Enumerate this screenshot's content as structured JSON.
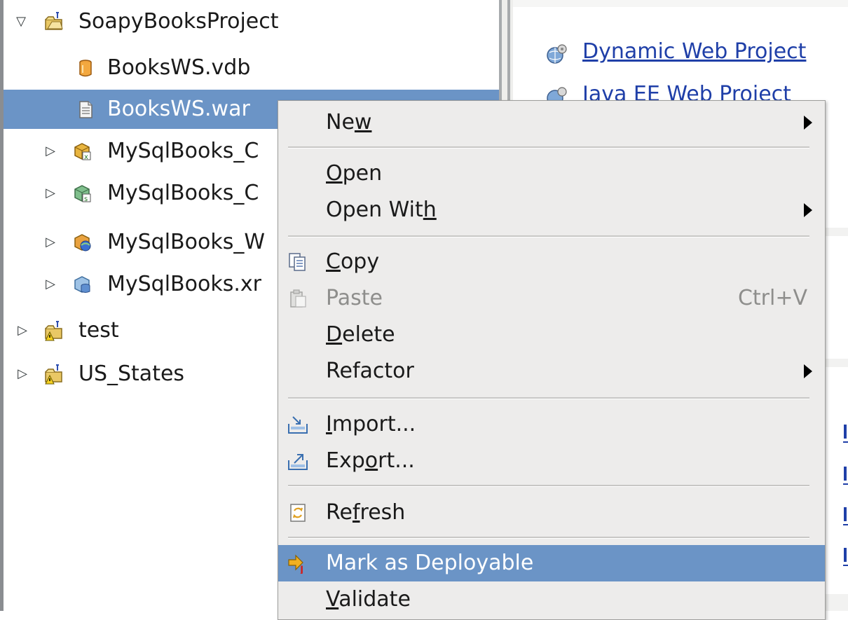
{
  "tree": {
    "items": [
      {
        "label": "SoapyBooksProject",
        "expander": "expanded-triangle",
        "icon": "project-folder-icon"
      },
      {
        "label": "BooksWS.vdb",
        "icon": "vdb-cylinder-icon"
      },
      {
        "label": "BooksWS.war",
        "icon": "war-file-icon"
      },
      {
        "label": "MySqlBooks_C",
        "expander": "collapsed-triangle",
        "icon": "model-xsd-icon"
      },
      {
        "label": "MySqlBooks_C",
        "expander": "collapsed-triangle",
        "icon": "model-source-icon"
      },
      {
        "label": "MySqlBooks_W",
        "expander": "collapsed-triangle",
        "icon": "model-webservice-icon"
      },
      {
        "label": "MySqlBooks.xr",
        "expander": "collapsed-triangle",
        "icon": "model-relational-icon"
      },
      {
        "label": "test",
        "expander": "collapsed-triangle",
        "icon": "project-warning-icon"
      },
      {
        "label": "US_States",
        "expander": "collapsed-triangle",
        "icon": "project-warning-icon"
      }
    ]
  },
  "right_panel": {
    "links": [
      {
        "label": "Dynamic Web Project",
        "icon": "globe-gear-icon"
      },
      {
        "label": "Java EE Web Project",
        "icon": "globe-gear-icon"
      }
    ]
  },
  "context_menu": {
    "new": {
      "pre": "Ne",
      "mn": "w",
      "post": ""
    },
    "open": {
      "pre": "",
      "mn": "O",
      "post": "pen"
    },
    "open_with": {
      "pre": "Open Wit",
      "mn": "h",
      "post": ""
    },
    "copy": {
      "pre": "",
      "mn": "C",
      "post": "opy"
    },
    "paste": {
      "label": "Paste",
      "accel": "Ctrl+V"
    },
    "delete": {
      "pre": "",
      "mn": "D",
      "post": "elete"
    },
    "refactor": {
      "label": "Refactor"
    },
    "import": {
      "pre": "",
      "mn": "I",
      "post": "mport..."
    },
    "export": {
      "pre": "Exp",
      "mn": "o",
      "post": "rt..."
    },
    "refresh": {
      "pre": "Re",
      "mn": "f",
      "post": "resh"
    },
    "mark_deployable": {
      "label": "Mark as Deployable"
    },
    "validate": {
      "pre": "",
      "mn": "V",
      "post": "alidate"
    }
  },
  "colors": {
    "selection": "#6b94c6",
    "link": "#1f3fa8",
    "menu_bg": "#edeceb"
  }
}
